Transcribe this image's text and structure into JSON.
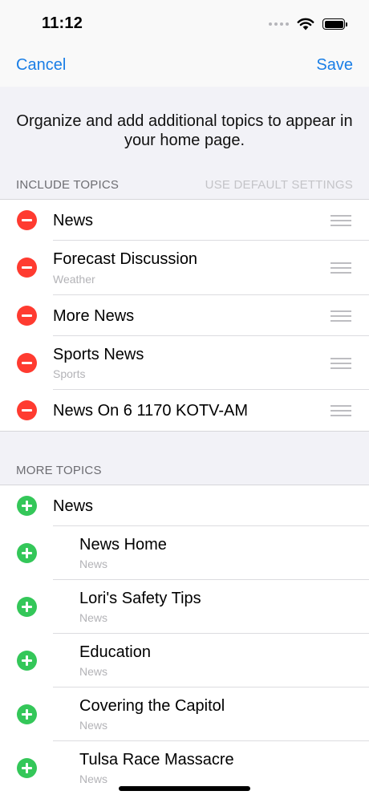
{
  "status": {
    "time": "11:12"
  },
  "nav": {
    "cancel_label": "Cancel",
    "save_label": "Save"
  },
  "intro_text": "Organize and add additional topics to appear in your home page.",
  "include_section": {
    "header": "INCLUDE TOPICS",
    "default_link": "USE DEFAULT SETTINGS",
    "items": [
      {
        "title": "News",
        "subtitle": ""
      },
      {
        "title": "Forecast Discussion",
        "subtitle": "Weather"
      },
      {
        "title": "More News",
        "subtitle": ""
      },
      {
        "title": "Sports News",
        "subtitle": "Sports"
      },
      {
        "title": "News On 6 1170 KOTV-AM",
        "subtitle": ""
      }
    ]
  },
  "more_section": {
    "header": "MORE TOPICS",
    "items": [
      {
        "title": "News",
        "subtitle": ""
      },
      {
        "title": "News Home",
        "subtitle": "News"
      },
      {
        "title": "Lori's Safety Tips",
        "subtitle": "News"
      },
      {
        "title": "Education",
        "subtitle": "News"
      },
      {
        "title": "Covering the Capitol",
        "subtitle": "News"
      },
      {
        "title": "Tulsa Race Massacre",
        "subtitle": "News"
      }
    ]
  },
  "colors": {
    "accent": "#1a7ee6",
    "remove": "#ff3b30",
    "add": "#34c759"
  }
}
